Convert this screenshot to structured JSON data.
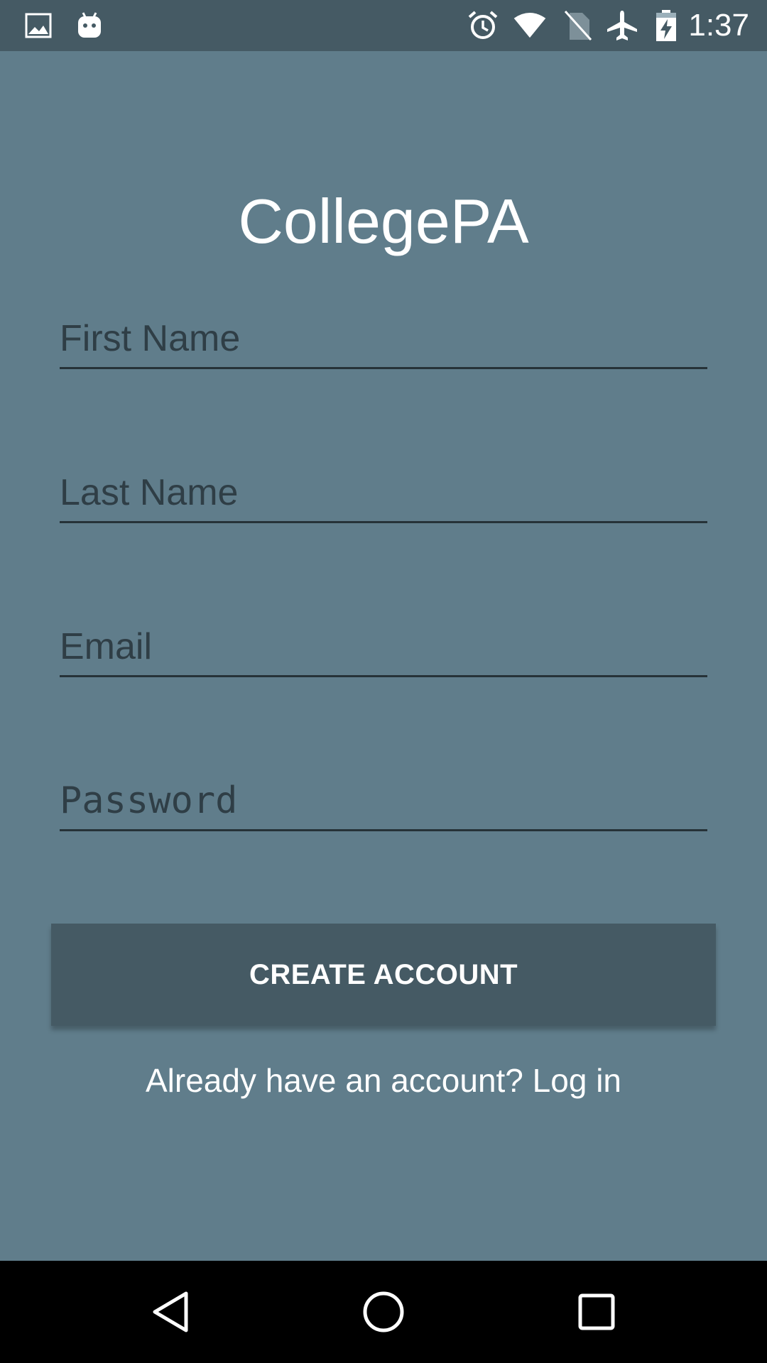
{
  "status_bar": {
    "time": "1:37",
    "icons": [
      "image-icon",
      "android-icon",
      "alarm-icon",
      "wifi-icon",
      "no-sim-icon",
      "airplane-mode-icon",
      "battery-charging-icon"
    ]
  },
  "app": {
    "title": "CollegePA"
  },
  "form": {
    "first_name_placeholder": "First Name",
    "last_name_placeholder": "Last Name",
    "email_placeholder": "Email",
    "password_placeholder": "Password",
    "first_name_value": "",
    "last_name_value": "",
    "email_value": "",
    "password_value": ""
  },
  "actions": {
    "create_account_label": "CREATE ACCOUNT",
    "login_link_label": "Already have an account? Log in"
  },
  "nav_bar": {
    "icons": [
      "back-icon",
      "home-icon",
      "recents-icon"
    ]
  },
  "colors": {
    "background": "#607d8b",
    "status_bar": "#455a64",
    "button": "#455a64",
    "underline": "#263238",
    "nav_bar": "#000000"
  }
}
